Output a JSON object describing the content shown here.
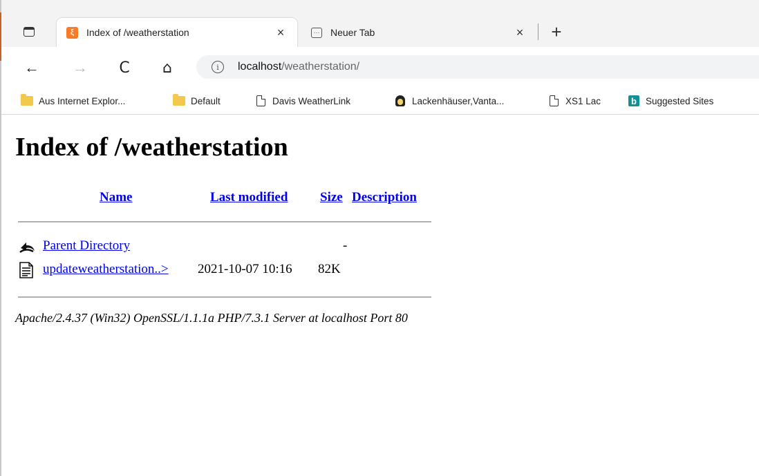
{
  "browser": {
    "tabs": [
      {
        "title": "Index of /weatherstation",
        "active": true,
        "favicon": "xampp-icon"
      },
      {
        "title": "Neuer Tab",
        "active": false,
        "favicon": "new-tab-page-icon"
      }
    ],
    "close_glyph": "×",
    "new_tab_glyph": "+",
    "nav": {
      "back": "←",
      "forward": "→",
      "refresh": "C",
      "home": "⌂",
      "info": "i"
    },
    "address": {
      "host": "localhost",
      "path": "/weatherstation/"
    },
    "favorites": [
      {
        "label": "Aus Internet Explor...",
        "icon": "folder-icon"
      },
      {
        "label": "Default",
        "icon": "folder-icon"
      },
      {
        "label": "Davis  WeatherLink",
        "icon": "page-icon"
      },
      {
        "label": "Lackenhäuser,Vanta...",
        "icon": "tux-icon"
      },
      {
        "label": "XS1 Lac",
        "icon": "page-icon"
      },
      {
        "label": "Suggested Sites",
        "icon": "bing-icon"
      }
    ],
    "bing_glyph": "b",
    "xampp_glyph": "ξ"
  },
  "page": {
    "heading": "Index of /weatherstation",
    "columns": {
      "name": "Name",
      "last_modified": "Last modified",
      "size": "Size",
      "description": "Description"
    },
    "rows": [
      {
        "name": "Parent Directory",
        "last_modified": "",
        "size": "-",
        "description": "",
        "icon": "back-arrow-icon"
      },
      {
        "name": "updateweatherstation..>",
        "last_modified": "2021-10-07 10:16",
        "size": "82K",
        "description": "",
        "icon": "text-file-icon"
      }
    ],
    "footer": "Apache/2.4.37 (Win32) OpenSSL/1.1.1a PHP/7.3.1 Server at localhost Port 80"
  },
  "colors": {
    "link": "#0000ee",
    "tab_strip": "#f3f3f3",
    "xampp_orange": "#fb7a24"
  }
}
